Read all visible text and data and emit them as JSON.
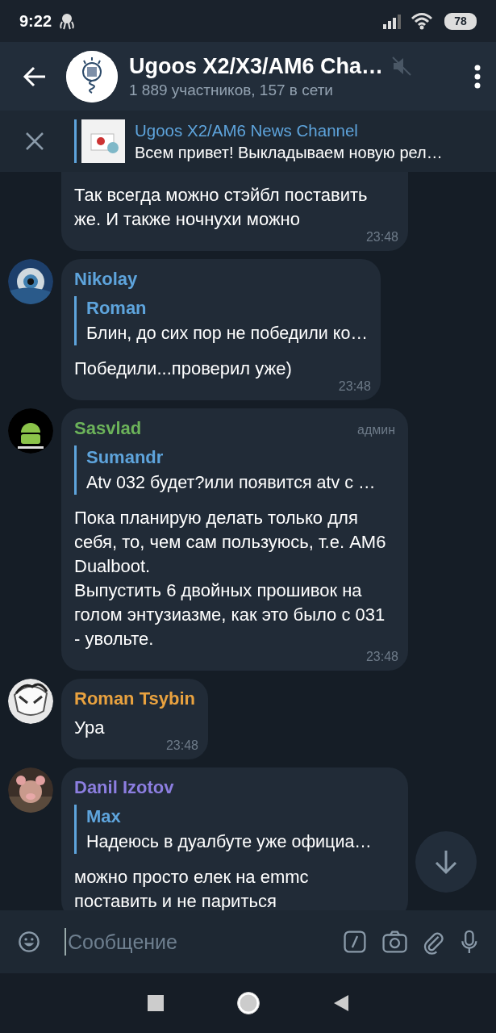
{
  "status_bar": {
    "time": "9:22",
    "battery": "78"
  },
  "header": {
    "title": "Ugoos X2/X3/AM6 Cha…",
    "subtitle": "1 889 участников, 157 в сети",
    "muted": true
  },
  "pinned": {
    "title": "Ugoos X2/AM6 News Channel",
    "text": "Всем привет! Выкладываем новую рел…"
  },
  "messages": [
    {
      "continued": true,
      "text": "Так всегда можно стэйбл поставить же. И также ночнухи можно",
      "time": "23:48"
    },
    {
      "sender": "Nikolay",
      "color": "#5ea4dc",
      "reply": {
        "author": "Roman",
        "text": "Блин, до сих пор не победили ко…"
      },
      "text": "Победили...проверил уже)",
      "time": "23:48"
    },
    {
      "sender": "Sasvlad",
      "color": "#6cb35a",
      "badge": "админ",
      "reply": {
        "author": "Sumandr",
        "text": "Atv 032 будет?или появится atv с …"
      },
      "text": "Пока планирую делать только для себя, то, чем сам пользуюсь, т.е. AM6 Dualboot.\nВыпустить 6 двойных прошивок на голом энтузиазме, как это было с 031 - увольте.",
      "time": "23:48"
    },
    {
      "sender": "Roman Tsybin",
      "color": "#e9a23f",
      "text": "Ура",
      "time": "23:48"
    },
    {
      "sender": "Danil Izotov",
      "color": "#8c7ee0",
      "reply": {
        "author": "Max",
        "text": "Надеюсь в дуалбуте уже официа…"
      },
      "text": "можно просто елек на emmc поставить и не париться"
    }
  ],
  "composer": {
    "placeholder": "Сообщение"
  }
}
